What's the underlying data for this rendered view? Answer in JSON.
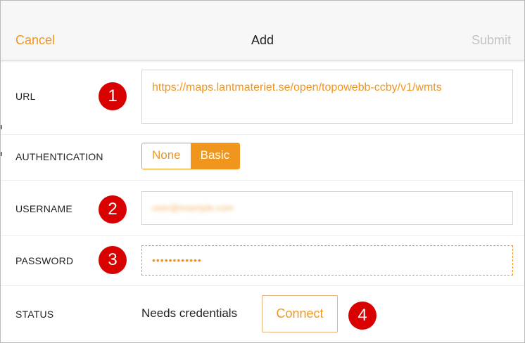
{
  "header": {
    "cancel_label": "Cancel",
    "title": "Add",
    "submit_label": "Submit"
  },
  "form": {
    "url": {
      "label": "URL",
      "value": "https://maps.lantmateriet.se/open/topowebb-ccby/v1/wmts"
    },
    "authentication": {
      "label": "AUTHENTICATION",
      "options": [
        "None",
        "Basic"
      ],
      "selected": "Basic"
    },
    "username": {
      "label": "USERNAME",
      "value": "user@example.com"
    },
    "password": {
      "label": "PASSWORD",
      "value": "••••••••••••"
    },
    "status": {
      "label": "STATUS",
      "text": "Needs credentials",
      "connect_label": "Connect"
    }
  },
  "callouts": [
    "1",
    "2",
    "3",
    "4"
  ],
  "colors": {
    "accent": "#f0961e",
    "callout": "#d80000",
    "disabled": "#c3c3c3"
  }
}
